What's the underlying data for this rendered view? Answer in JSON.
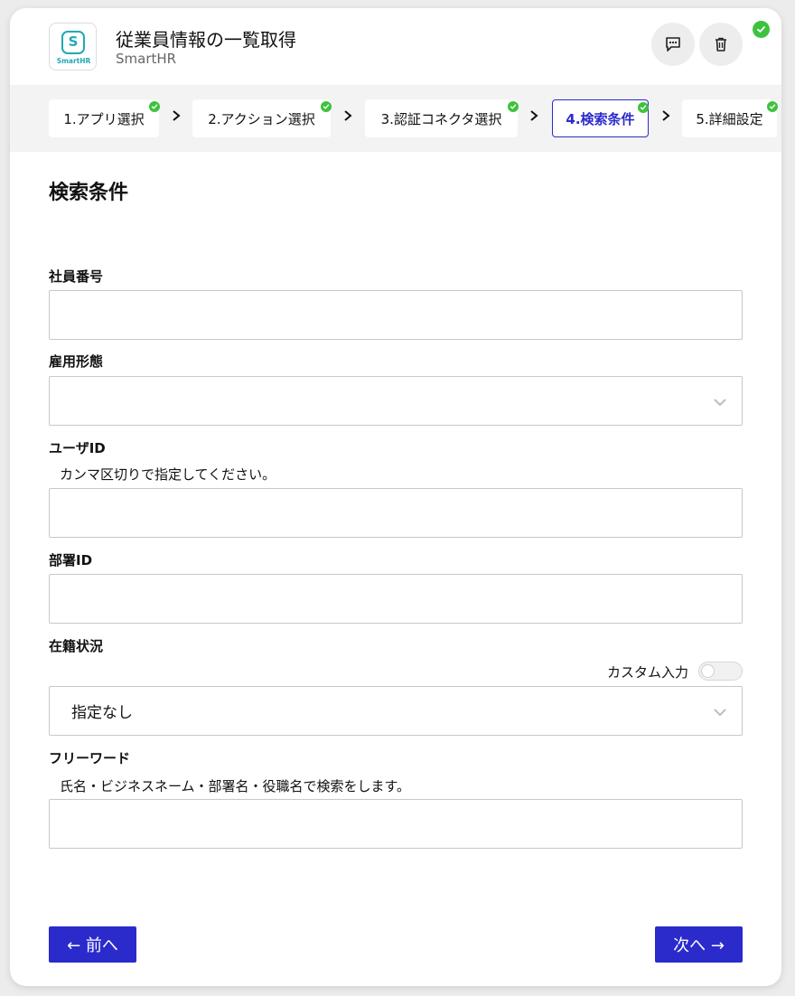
{
  "header": {
    "app_title": "従業員情報の一覧取得",
    "app_subtitle": "SmartHR",
    "logo_text": "SmartHR"
  },
  "steps": [
    {
      "label": "1.アプリ選択",
      "done": true
    },
    {
      "label": "2.アクション選択",
      "done": true
    },
    {
      "label": "3.認証コネクタ選択",
      "done": true
    },
    {
      "label": "4.検索条件",
      "done": true,
      "active": true
    },
    {
      "label": "5.詳細設定",
      "done": true
    }
  ],
  "section": {
    "title": "検索条件"
  },
  "fields": {
    "employee_number": {
      "label": "社員番号",
      "value": ""
    },
    "employment_type": {
      "label": "雇用形態",
      "value": ""
    },
    "user_id": {
      "label": "ユーザID",
      "help": "カンマ区切りで指定してください。",
      "value": ""
    },
    "department_id": {
      "label": "部署ID",
      "value": ""
    },
    "employment_status": {
      "label": "在籍状況",
      "value": "指定なし",
      "custom_input_label": "カスタム入力",
      "custom_input_on": false
    },
    "free_word": {
      "label": "フリーワード",
      "help": "氏名・ビジネスネーム・部署名・役職名で検索をします。",
      "value": ""
    }
  },
  "footer": {
    "prev_label": "← 前へ",
    "next_label": "次へ →"
  },
  "colors": {
    "accent": "#2b2bcc",
    "success": "#3ec23e",
    "logo": "#23a8b5"
  }
}
